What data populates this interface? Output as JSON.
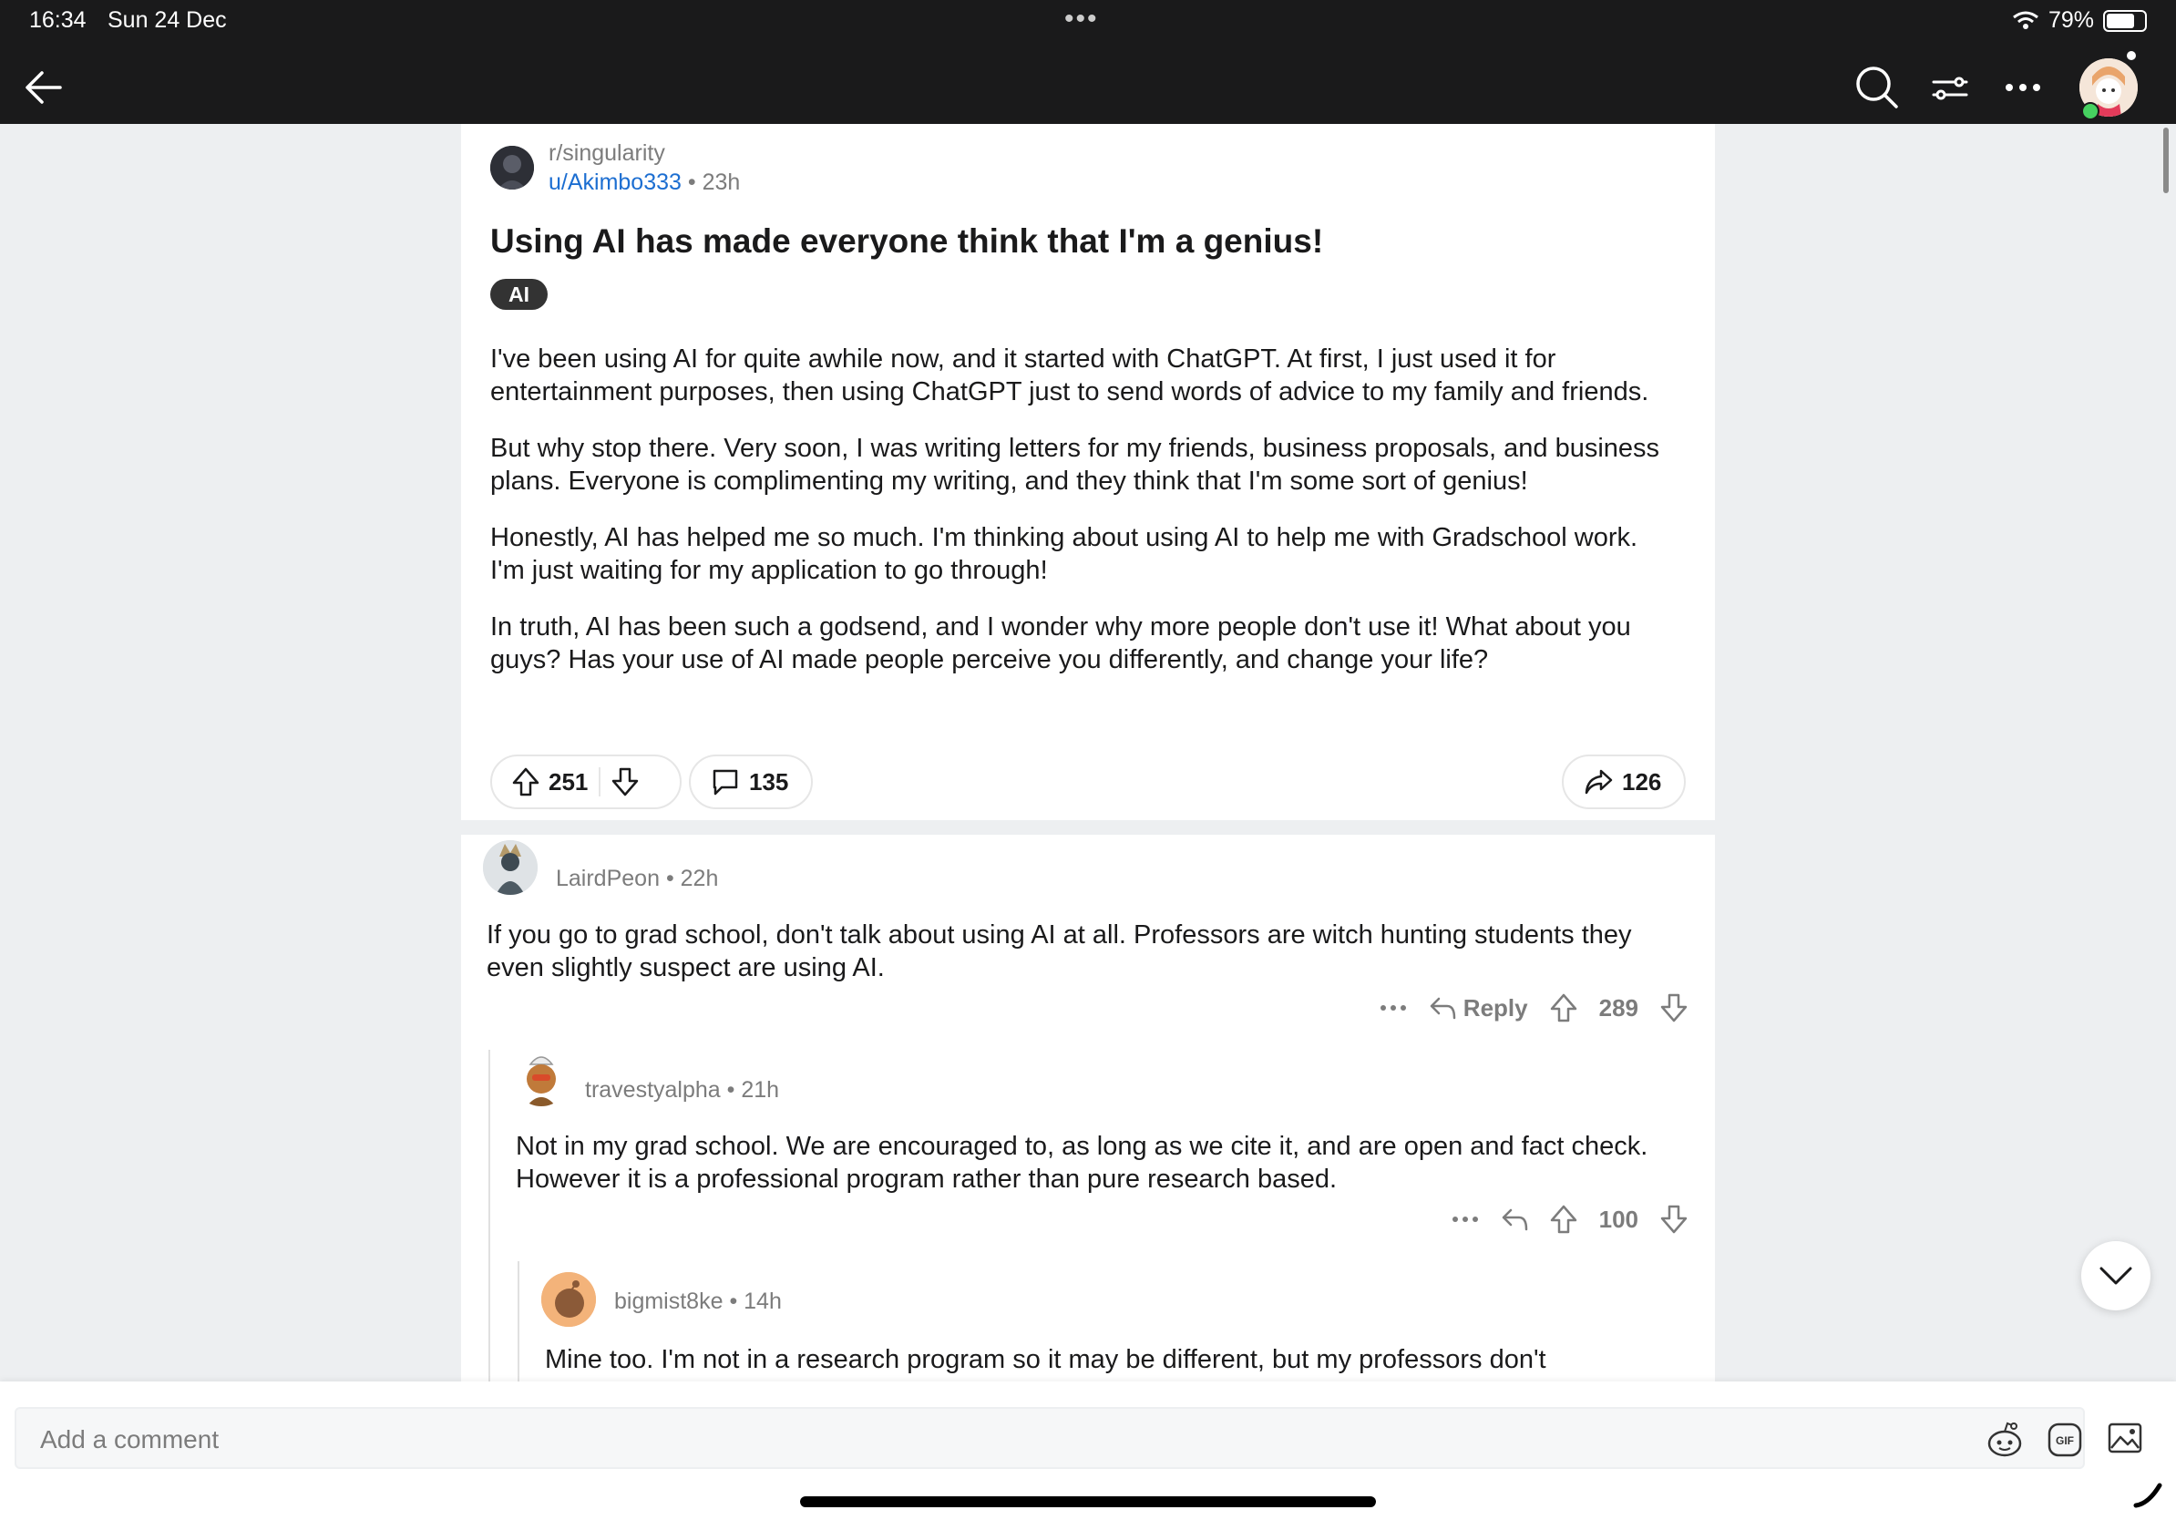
{
  "status_bar": {
    "time": "16:34",
    "date": "Sun 24 Dec",
    "battery": "79%"
  },
  "post": {
    "subreddit": "r/singularity",
    "author": "u/Akimbo333",
    "age": "23h",
    "title": "Using AI has made everyone think that I'm a genius!",
    "flair": "AI",
    "body": [
      "I've been using AI for quite awhile now, and it started with ChatGPT. At first, I just used it for entertainment purposes, then using ChatGPT just to send words of advice to my family and friends.",
      "But why stop there. Very soon, I was writing letters for my friends, business proposals, and business plans. Everyone is complimenting my writing, and they think that I'm some sort of genius!",
      "Honestly, AI has helped me so much. I'm thinking about using AI to help me with Gradschool work. I'm just waiting for my application to go through!",
      "In truth, AI has been such a godsend, and I wonder why more people don't use it! What about you guys? Has your use of AI made people perceive you differently, and change your life?"
    ],
    "votes": "251",
    "comments": "135",
    "shares": "126"
  },
  "comments": [
    {
      "user": "LairdPeon",
      "age": "22h",
      "text": "If you go to grad school, don't talk about using AI at all. Professors are witch hunting students they even slightly suspect are using AI.",
      "reply_label": "Reply",
      "votes": "289"
    },
    {
      "user": "travestyalpha",
      "age": "21h",
      "text": "Not in my grad school. We are encouraged to, as long as we cite it, and are open  and fact check. However it is a professional program rather than pure research based.",
      "votes": "100"
    },
    {
      "user": "bigmist8ke",
      "age": "14h",
      "text": "Mine too. I'm not in a research program so it may be different, but my professors don't"
    }
  ],
  "composer": {
    "placeholder": "Add a comment"
  },
  "icons": {
    "back": "back-arrow-icon",
    "search": "search-icon",
    "filter": "sort-icon",
    "more": "more-icon",
    "upvote": "upvote-icon",
    "downvote": "downvote-icon",
    "comment": "comment-bubble-icon",
    "share": "share-icon",
    "reply": "reply-icon",
    "collapse": "chevron-down-icon",
    "snoo": "snoo-emoji-icon",
    "gif": "gif-icon",
    "image": "image-icon"
  },
  "colors": {
    "link": "#1c6ed1",
    "topbar": "#1a1a1b",
    "online": "#46d160"
  }
}
